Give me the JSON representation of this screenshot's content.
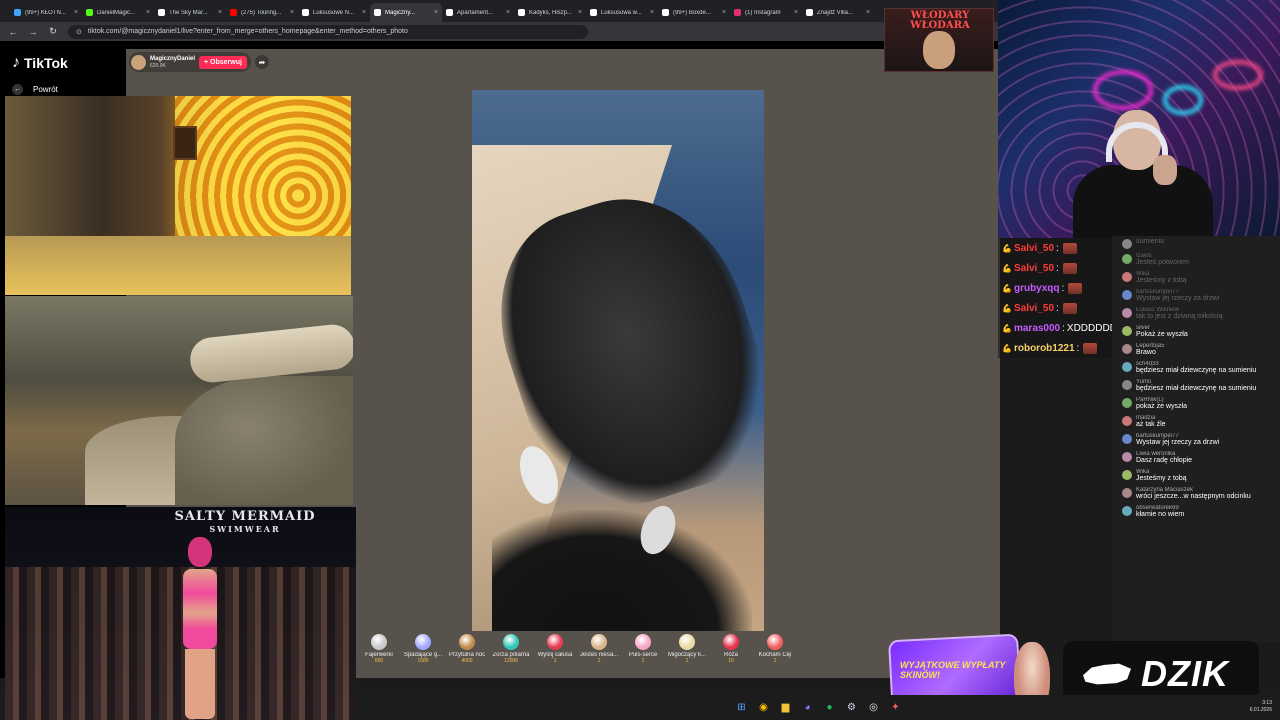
{
  "browser": {
    "tabs": [
      {
        "label": "(99+) KŁOTN...",
        "fav": "#3ea6ff"
      },
      {
        "label": "DanielMagic...",
        "fav": "#53fc18"
      },
      {
        "label": "The Sky Mar...",
        "fav": "#ffffff"
      },
      {
        "label": "(275) Touring...",
        "fav": "#ff0000"
      },
      {
        "label": "Luksusowe N...",
        "fav": "#ffffff"
      },
      {
        "label": "Magiczny...",
        "fav": "#ffffff",
        "active": true
      },
      {
        "label": "Apartament...",
        "fav": "#ffffff"
      },
      {
        "label": "Kadyks, Hiszp...",
        "fav": "#ffffff"
      },
      {
        "label": "Luksusowa w...",
        "fav": "#ffffff"
      },
      {
        "label": "(99+) Boxde...",
        "fav": "#ffffff"
      },
      {
        "label": "(1) Instagram",
        "fav": "#e1306c"
      },
      {
        "label": "Znajdź Villa...",
        "fav": "#ffffff"
      }
    ],
    "url": "tiktok.com/@magicznydaniel1/live?enter_from_merge=others_homepage&enter_method=others_photo"
  },
  "tiktok": {
    "logo": "TikTok",
    "back_label": "Powrót",
    "host_name": "MagicznyDaniel",
    "host_count": "620.9K",
    "follow_label": "+ Obserwuj"
  },
  "gifts": [
    {
      "name": "Fajerwerki",
      "price": "600",
      "color": "#c9c9c9"
    },
    {
      "name": "Spadające g...",
      "price": "1580",
      "color": "#9fa8ff"
    },
    {
      "name": "Przytulna noc",
      "price": "4000",
      "color": "#c28a4a"
    },
    {
      "name": "Zorza polarna",
      "price": "12000",
      "color": "#2fc7b5"
    },
    {
      "name": "Wyślij całusa",
      "price": "1",
      "color": "#e73b4f"
    },
    {
      "name": "Jesteś niesa...",
      "price": "1",
      "color": "#d8b58a"
    },
    {
      "name": "Puls-serce",
      "price": "1",
      "color": "#f6a5c6"
    },
    {
      "name": "Migoczący k...",
      "price": "1",
      "color": "#e9d9a6"
    },
    {
      "name": "Róża",
      "price": "10",
      "color": "#e8334a"
    },
    {
      "name": "Kocham Cię",
      "price": "1",
      "color": "#f06060"
    }
  ],
  "overlays": {
    "brand_line1": "SALTY MERMAID",
    "brand_line2": "SWIMWEAR",
    "wlodary_title": "WŁODARY WŁODARA",
    "promo_text": "WYJĄTKOWE WYPŁATY SKINÓW!",
    "dzik": "DZIK"
  },
  "stream_chat": [
    {
      "user": "Salvi_50",
      "color": "#ff3b3b",
      "msg": ""
    },
    {
      "user": "Salvi_50",
      "color": "#ff3b3b",
      "msg": ""
    },
    {
      "user": "grubyxqq",
      "color": "#c65bff",
      "msg": ""
    },
    {
      "user": "Salvi_50",
      "color": "#ff3b3b",
      "msg": ""
    },
    {
      "user": "maras000",
      "color": "#c65bff",
      "msg": "XDDDDDDDDDDDDD"
    },
    {
      "user": "roborob1221",
      "color": "#f5d06a",
      "msg": ""
    }
  ],
  "tiktok_chat": [
    {
      "user": "",
      "text": "sumieniu",
      "faded": true
    },
    {
      "user": "Izaels",
      "text": "Jesteś potworem",
      "faded": true
    },
    {
      "user": "Wika",
      "text": "Jesteśmy z tobą",
      "faded": true
    },
    {
      "user": "bartuskumpel77",
      "text": "Wystaw jej rzeczy za drzwi",
      "faded": true
    },
    {
      "user": "Łukasz Wiśniew",
      "text": "tak to jest z dziwną miłością",
      "faded": true
    },
    {
      "user": "silver",
      "text": "Pokaż że wyszła"
    },
    {
      "user": "Lepertoja5",
      "text": "Brawo"
    },
    {
      "user": "sch4d33",
      "text": "będziesz miał dziewczynę na sumieniu"
    },
    {
      "user": "Yumo",
      "text": "będziesz miał dziewczynę na sumieniu"
    },
    {
      "user": "PaRNik(L)",
      "text": "pokaż że wyszła"
    },
    {
      "user": "madzia",
      "text": "aż tak źle"
    },
    {
      "user": "bartuskumpel77",
      "text": "Wystaw jej rzeczy za drzwi"
    },
    {
      "user": "Liwia weronika",
      "text": "Dasz radę chłopie"
    },
    {
      "user": "Wika",
      "text": "Jesteśmy z tobą"
    },
    {
      "user": "Katarzyna Maciaszek",
      "text": "wróci jeszcze...w następnym odcinku"
    },
    {
      "user": "obserwatorek69",
      "text": "kłamie no wiem"
    }
  ],
  "taskbar": {
    "time": "3:13",
    "date": "6.01.2026"
  }
}
